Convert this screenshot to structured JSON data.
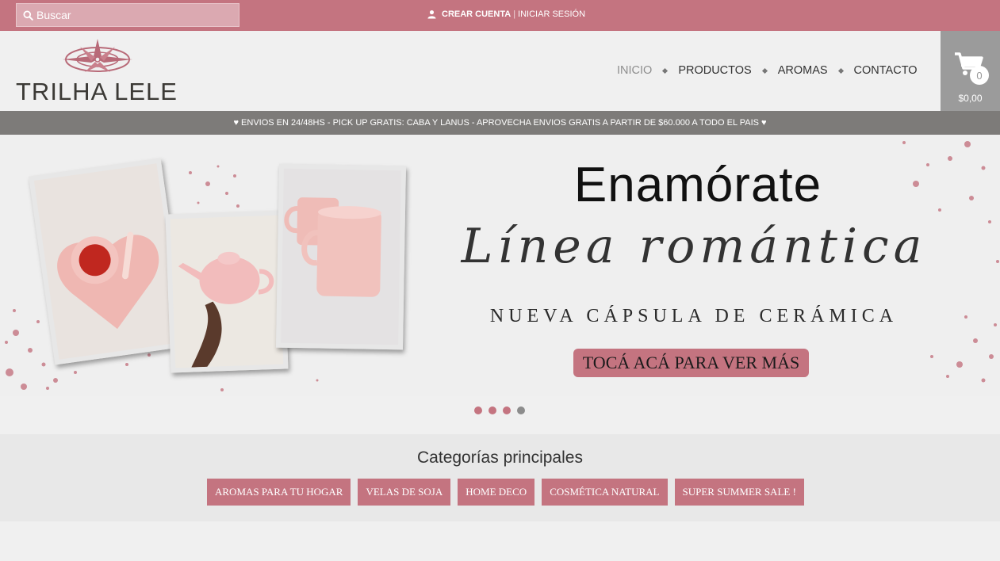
{
  "colors": {
    "brand": "#c47480",
    "announce_bg": "#7d7b79",
    "cart_bg": "#9b9b9b"
  },
  "topbar": {
    "search_placeholder": "Buscar",
    "create_account": "CREAR CUENTA",
    "separator": "|",
    "login": "INICIAR SESIÓN"
  },
  "header": {
    "logo_text": "TRILHA LELE",
    "nav": [
      {
        "label": "INICIO",
        "active": true
      },
      {
        "label": "PRODUCTOS",
        "active": false
      },
      {
        "label": "AROMAS",
        "active": false
      },
      {
        "label": "CONTACTO",
        "active": false
      }
    ],
    "cart": {
      "count": "0",
      "total": "$0,00"
    }
  },
  "announcement": "♥ ENVIOS EN 24/48HS - PICK UP GRATIS: CABA Y LANUS - APROVECHA ENVIOS GRATIS A PARTIR DE $60.000 A TODO EL PAIS ♥",
  "banner": {
    "headline": "Enamórate",
    "script_line": "Línea romántica",
    "subline": "NUEVA CÁPSULA DE CERÁMICA",
    "cta": "TOCÁ ACÁ PARA VER MÁS",
    "slides": 4,
    "active_slide": 4
  },
  "categories": {
    "title": "Categorías principales",
    "items": [
      "AROMAS PARA TU HOGAR",
      "VELAS DE SOJA",
      "HOME DECO",
      "COSMÉTICA NATURAL",
      "SUPER SUMMER SALE !"
    ]
  }
}
